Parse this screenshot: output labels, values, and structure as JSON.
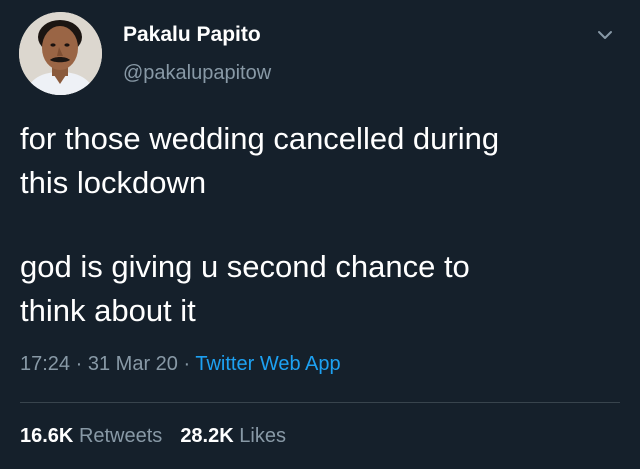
{
  "tweet": {
    "author": {
      "display_name": "Pakalu Papito",
      "handle": "@pakalupapitow"
    },
    "text_lines": [
      "for those wedding cancelled during",
      "this lockdown",
      "god is giving u second chance to",
      "think about it"
    ],
    "time": "17:24",
    "separator": "·",
    "date": "31 Mar 20",
    "source": "Twitter Web App",
    "retweets": {
      "count": "16.6K",
      "label": "Retweets"
    },
    "likes": {
      "count": "28.2K",
      "label": "Likes"
    }
  },
  "icons": {
    "menu": "chevron-down-icon",
    "avatar": "avatar-photo"
  },
  "colors": {
    "background": "#15202b",
    "primary_text": "#ffffff",
    "secondary_text": "#8899a6",
    "link": "#1da1f2",
    "divider": "#38444d"
  }
}
